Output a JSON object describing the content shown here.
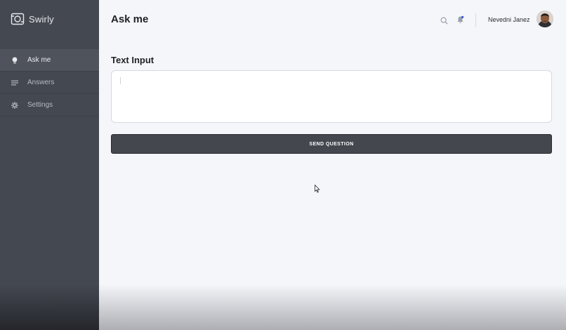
{
  "app": {
    "name": "Swirly",
    "logo_icon": "swirly-logo-icon"
  },
  "sidebar": {
    "items": [
      {
        "label": "Ask me",
        "icon": "lightbulb-icon",
        "active": true
      },
      {
        "label": "Answers",
        "icon": "list-icon",
        "active": false
      },
      {
        "label": "Settings",
        "icon": "gear-icon",
        "active": false
      }
    ]
  },
  "header": {
    "title": "Ask me",
    "search_icon": "search-icon",
    "notification_icon": "bell-icon",
    "user_name": "Nevedni Janez"
  },
  "main": {
    "section_title": "Text Input",
    "input_value": "",
    "send_label": "SEND QUESTION"
  },
  "colors": {
    "sidebar_bg": "#444851",
    "sidebar_active": "#4f535c",
    "content_bg": "#f5f6fa",
    "button_bg": "#44474e",
    "notification_dot": "#3b5bdb"
  }
}
